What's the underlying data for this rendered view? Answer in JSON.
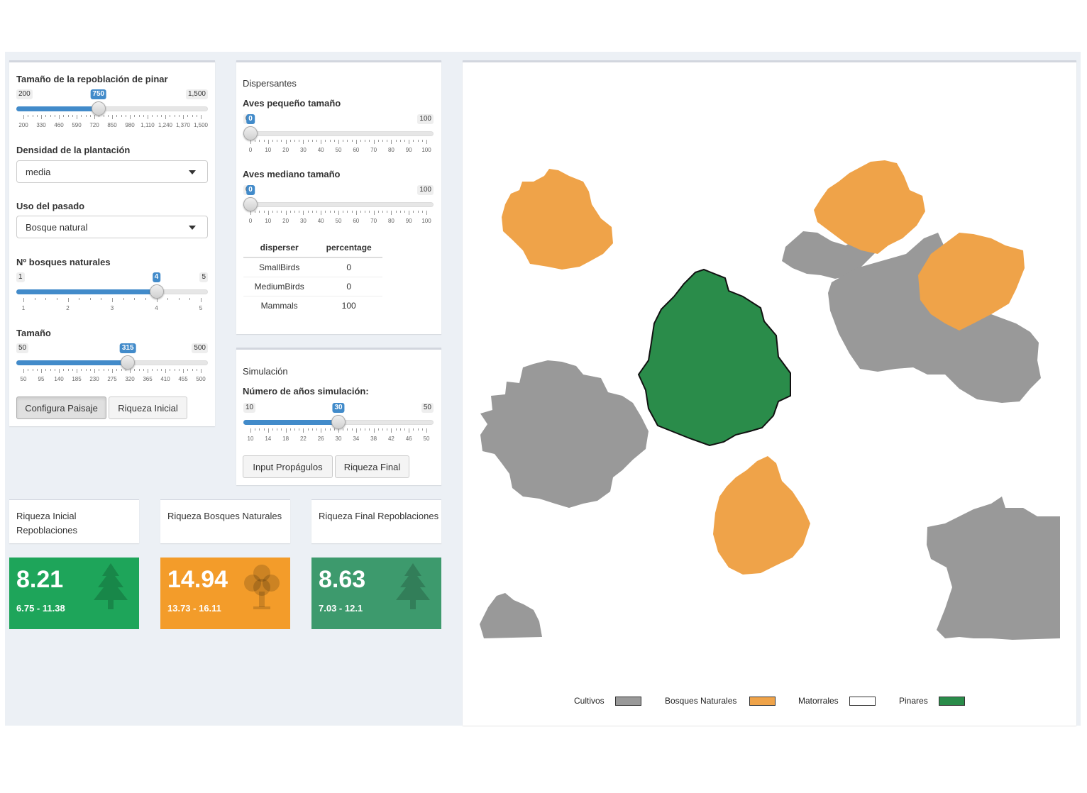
{
  "colors": {
    "cultivos": "#999999",
    "bosques": "#efa349",
    "matorrales": "#ffffff",
    "pinares": "#2a8c4a",
    "slider_blue": "#428bca",
    "green_box": "#1ea55a",
    "orange_box": "#f39c2a",
    "teal_box": "#3d9a6d"
  },
  "left_panel": {
    "size_slider": {
      "label": "Tamaño de la repoblación de pinar",
      "min_label": "200",
      "max_label": "1,500",
      "value_label": "750",
      "min": 200,
      "max": 1500,
      "value": 750,
      "tick_labels": [
        "200",
        "330",
        "460",
        "590",
        "720",
        "850",
        "980",
        "1,110",
        "1,240",
        "1,370",
        "1,500"
      ]
    },
    "density": {
      "label": "Densidad de la plantación",
      "value": "media"
    },
    "past_use": {
      "label": "Uso del pasado",
      "value": "Bosque natural"
    },
    "forests_slider": {
      "label": "Nº bosques naturales",
      "min_label": "1",
      "max_label": "5",
      "value_label": "4",
      "min": 1,
      "max": 5,
      "value": 4,
      "tick_labels": [
        "1",
        "2",
        "3",
        "4",
        "5"
      ]
    },
    "tamano_slider": {
      "label": "Tamaño",
      "min_label": "50",
      "max_label": "500",
      "value_label": "315",
      "min": 50,
      "max": 500,
      "value": 315,
      "tick_labels": [
        "50",
        "95",
        "140",
        "185",
        "230",
        "275",
        "320",
        "365",
        "410",
        "455",
        "500"
      ]
    },
    "btn_config": "Configura Paisaje",
    "btn_riqueza_inicial": "Riqueza Inicial"
  },
  "dispersers_panel": {
    "title": "Dispersantes",
    "small_slider": {
      "label": "Aves pequeño tamaño",
      "min_label": "0",
      "max_label": "100",
      "value_label": "0",
      "min": 0,
      "max": 100,
      "value": 0,
      "tick_labels": [
        "0",
        "10",
        "20",
        "30",
        "40",
        "50",
        "60",
        "70",
        "80",
        "90",
        "100"
      ]
    },
    "medium_slider": {
      "label": "Aves mediano tamaño",
      "min_label": "0",
      "max_label": "100",
      "value_label": "0",
      "min": 0,
      "max": 100,
      "value": 0,
      "tick_labels": [
        "0",
        "10",
        "20",
        "30",
        "40",
        "50",
        "60",
        "70",
        "80",
        "90",
        "100"
      ]
    },
    "table": {
      "headers": [
        "disperser",
        "percentage"
      ],
      "rows": [
        [
          "SmallBirds",
          "0"
        ],
        [
          "MediumBirds",
          "0"
        ],
        [
          "Mammals",
          "100"
        ]
      ]
    }
  },
  "simulation_panel": {
    "title": "Simulación",
    "years_slider": {
      "label": "Número de años simulación:",
      "min_label": "10",
      "max_label": "50",
      "value_label": "30",
      "min": 10,
      "max": 50,
      "value": 30,
      "tick_labels": [
        "10",
        "14",
        "18",
        "22",
        "26",
        "30",
        "34",
        "38",
        "42",
        "46",
        "50"
      ]
    },
    "btn_input": "Input Propágulos",
    "btn_final": "Riqueza Final"
  },
  "title_boxes": [
    "Riqueza Inicial Repoblaciones",
    "Riqueza Bosques Naturales",
    "Riqueza Final Repoblaciones"
  ],
  "value_boxes": [
    {
      "value": "8.21",
      "range": "6.75 - 11.38",
      "icon": "pine-tree-icon"
    },
    {
      "value": "14.94",
      "range": "13.73 - 16.11",
      "icon": "deciduous-tree-icon"
    },
    {
      "value": "8.63",
      "range": "7.03 - 12.1",
      "icon": "pine-tree-icon"
    }
  ],
  "legend": [
    {
      "label": "Cultivos",
      "color": "#999999"
    },
    {
      "label": "Bosques Naturales",
      "color": "#efa349"
    },
    {
      "label": "Matorrales",
      "color": "#ffffff"
    },
    {
      "label": "Pinares",
      "color": "#2a8c4a"
    }
  ]
}
